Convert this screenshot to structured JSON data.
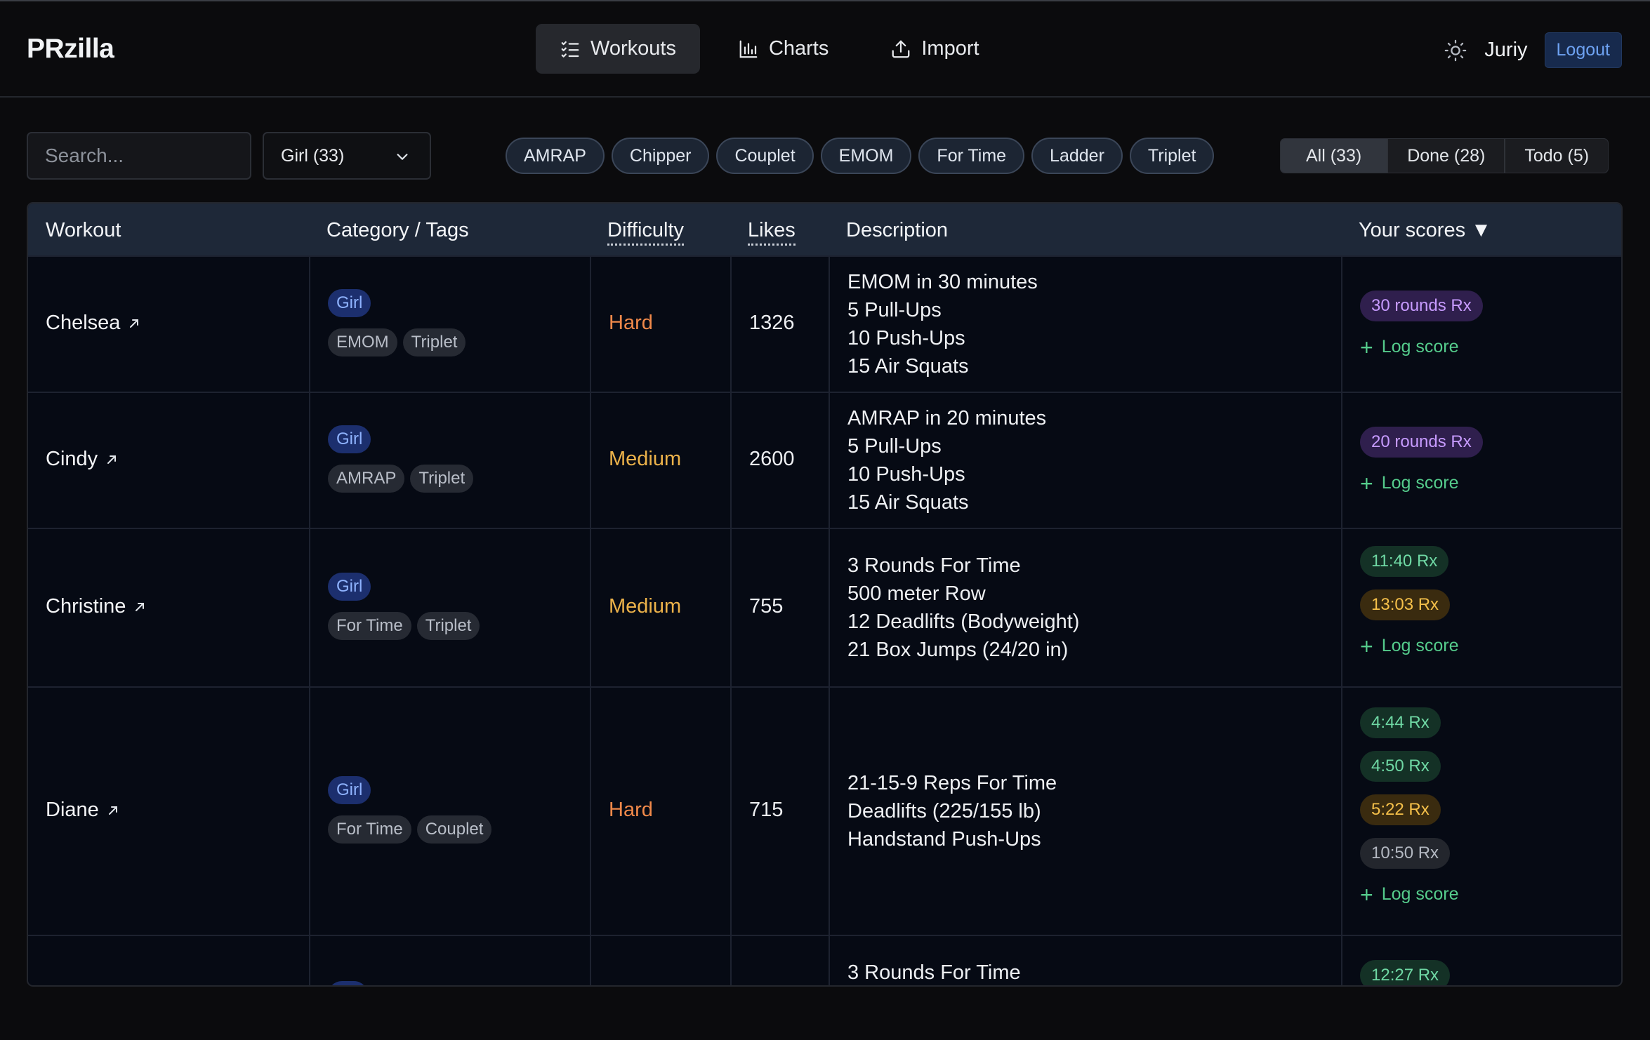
{
  "header": {
    "logo": "PRzilla",
    "nav": [
      {
        "label": "Workouts",
        "icon": "list-check-icon",
        "active": true
      },
      {
        "label": "Charts",
        "icon": "bar-chart-icon",
        "active": false
      },
      {
        "label": "Import",
        "icon": "upload-icon",
        "active": false
      }
    ],
    "theme_icon": "sun-icon",
    "username": "Juriy",
    "logout_label": "Logout"
  },
  "filters": {
    "search_placeholder": "Search...",
    "category_selected": "Girl (33)",
    "chips": [
      "AMRAP",
      "Chipper",
      "Couplet",
      "EMOM",
      "For Time",
      "Ladder",
      "Triplet"
    ],
    "status": [
      {
        "label": "All (33)",
        "active": true
      },
      {
        "label": "Done (28)",
        "active": false
      },
      {
        "label": "Todo (5)",
        "active": false
      }
    ]
  },
  "table": {
    "headers": {
      "workout": "Workout",
      "category": "Category / Tags",
      "difficulty": "Difficulty",
      "likes": "Likes",
      "description": "Description",
      "scores": "Your scores ▼"
    },
    "log_score_label": "Log score",
    "rows": [
      {
        "name": "Chelsea",
        "category": "Girl",
        "tags": [
          "EMOM",
          "Triplet"
        ],
        "difficulty": "Hard",
        "likes": "1326",
        "description": [
          "EMOM in 30 minutes",
          "5 Pull-Ups",
          "10 Push-Ups",
          "15 Air Squats"
        ],
        "scores": [
          {
            "text": "30 rounds Rx",
            "color": "purple"
          }
        ]
      },
      {
        "name": "Cindy",
        "category": "Girl",
        "tags": [
          "AMRAP",
          "Triplet"
        ],
        "difficulty": "Medium",
        "likes": "2600",
        "description": [
          "AMRAP in 20 minutes",
          "5 Pull-Ups",
          "10 Push-Ups",
          "15 Air Squats"
        ],
        "scores": [
          {
            "text": "20 rounds Rx",
            "color": "purple"
          }
        ]
      },
      {
        "name": "Christine",
        "category": "Girl",
        "tags": [
          "For Time",
          "Triplet"
        ],
        "difficulty": "Medium",
        "likes": "755",
        "description": [
          "3 Rounds For Time",
          "500 meter Row",
          "12 Deadlifts (Bodyweight)",
          "21 Box Jumps (24/20 in)"
        ],
        "scores": [
          {
            "text": "11:40 Rx",
            "color": "green"
          },
          {
            "text": "13:03 Rx",
            "color": "amber"
          }
        ]
      },
      {
        "name": "Diane",
        "category": "Girl",
        "tags": [
          "For Time",
          "Couplet"
        ],
        "difficulty": "Hard",
        "likes": "715",
        "description": [
          "21-15-9 Reps For Time",
          "Deadlifts (225/155 lb)",
          "Handstand Push-Ups"
        ],
        "scores": [
          {
            "text": "4:44 Rx",
            "color": "green"
          },
          {
            "text": "4:50 Rx",
            "color": "green"
          },
          {
            "text": "5:22 Rx",
            "color": "amber"
          },
          {
            "text": "10:50 Rx",
            "color": "gray"
          }
        ]
      },
      {
        "name": "",
        "category": "",
        "tags": [],
        "difficulty": "",
        "likes": "",
        "description": [
          "3 Rounds For Time"
        ],
        "scores": [
          {
            "text": "12:27 Rx",
            "color": "green"
          }
        ]
      }
    ]
  }
}
